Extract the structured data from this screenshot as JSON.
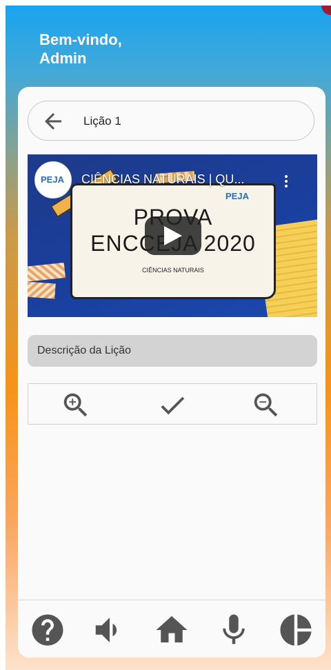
{
  "header": {
    "welcome_line1": "Bem-vindo,",
    "welcome_line2": "Admin"
  },
  "lesson": {
    "title": "Lição 1"
  },
  "video": {
    "title": "CIÊNCIAS NATURAIS | QU...",
    "channel_logo_text": "PEJA",
    "thumbnail_brand": "PEJA",
    "thumbnail_line1": "PROVA",
    "thumbnail_line2": "ENCCEJA 2020",
    "thumbnail_subtitle": "CIÊNCIAS NATURAIS"
  },
  "description": {
    "label": "Descrição da Lição"
  },
  "toolbar": {
    "icons": [
      "zoom-in-icon",
      "check-icon",
      "zoom-out-icon"
    ]
  },
  "bottom_nav": {
    "icons": [
      "help-icon",
      "volume-icon",
      "home-icon",
      "microphone-icon",
      "chart-icon"
    ]
  },
  "colors": {
    "gradient_top": "#1aa3ee",
    "gradient_mid": "#f7931a",
    "gradient_bottom": "#fde2cc",
    "card": "#fafafa",
    "icon": "#555555"
  }
}
